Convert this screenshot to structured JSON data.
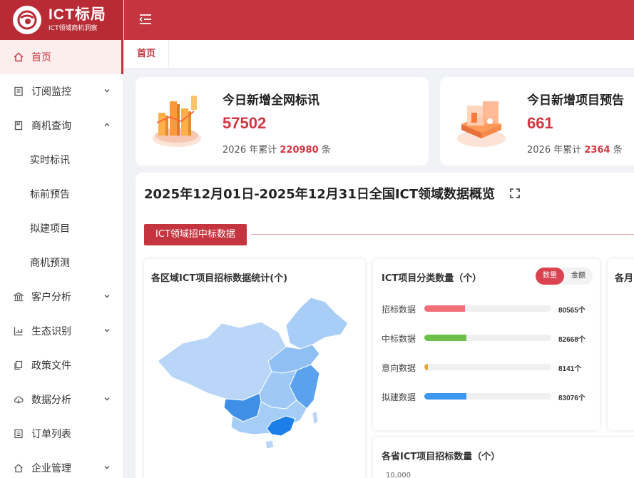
{
  "brand": {
    "title": "ICT标局",
    "subtitle": "ICT领域商机洞察"
  },
  "sidebar": {
    "items": [
      {
        "label": "首页",
        "icon": "home-icon",
        "active": true
      },
      {
        "label": "订阅监控",
        "icon": "subscribe-icon",
        "expand": "down"
      },
      {
        "label": "商机查询",
        "icon": "document-icon",
        "expand": "up"
      },
      {
        "label": "实时标讯",
        "sub": true
      },
      {
        "label": "标前预告",
        "sub": true
      },
      {
        "label": "拟建项目",
        "sub": true
      },
      {
        "label": "商机预测",
        "sub": true
      },
      {
        "label": "客户分析",
        "icon": "bank-icon",
        "expand": "down"
      },
      {
        "label": "生态识别",
        "icon": "chart-icon",
        "expand": "down"
      },
      {
        "label": "政策文件",
        "icon": "copy-icon"
      },
      {
        "label": "数据分析",
        "icon": "cloud-icon",
        "expand": "down"
      },
      {
        "label": "订单列表",
        "icon": "list-icon"
      },
      {
        "label": "企业管理",
        "icon": "building-icon",
        "expand": "down"
      }
    ]
  },
  "tabs": [
    {
      "label": "首页"
    }
  ],
  "stats": [
    {
      "title": "今日新增全网标讯",
      "value": "57502",
      "sub_prefix": "2026 年累计",
      "sub_value": "220980",
      "sub_suffix": "条"
    },
    {
      "title": "今日新增项目预告",
      "value": "661",
      "sub_prefix": "2026 年累计",
      "sub_value": "2364",
      "sub_suffix": "条"
    }
  ],
  "overview": {
    "title": "2025年12月01日-2025年12月31日全国ICT领域数据概览",
    "section": "ICT领域招中标数据",
    "map_card": {
      "title": "各区域ICT项目招标数据统计(个)"
    },
    "category_card": {
      "title": "ICT项目分类数量（个）",
      "toggle": [
        "数量",
        "金额"
      ],
      "rows": [
        {
          "label": "招标数据",
          "value": "80565个",
          "fill": 0.32,
          "color": "#f07079"
        },
        {
          "label": "中标数据",
          "value": "82668个",
          "fill": 0.33,
          "color": "#6cc04a"
        },
        {
          "label": "意向数据",
          "value": "8141个",
          "fill": 0.03,
          "color": "#e8a33c"
        },
        {
          "label": "拟建数据",
          "value": "83076个",
          "fill": 0.33,
          "color": "#3d97f0"
        }
      ]
    },
    "monthly_card": {
      "title": "各月"
    },
    "province_card": {
      "title": "各省ICT项目招标数量（个）",
      "axis_top": "10,000"
    }
  },
  "colors": {
    "brand": "#c5353f",
    "accent": "#d53641"
  }
}
